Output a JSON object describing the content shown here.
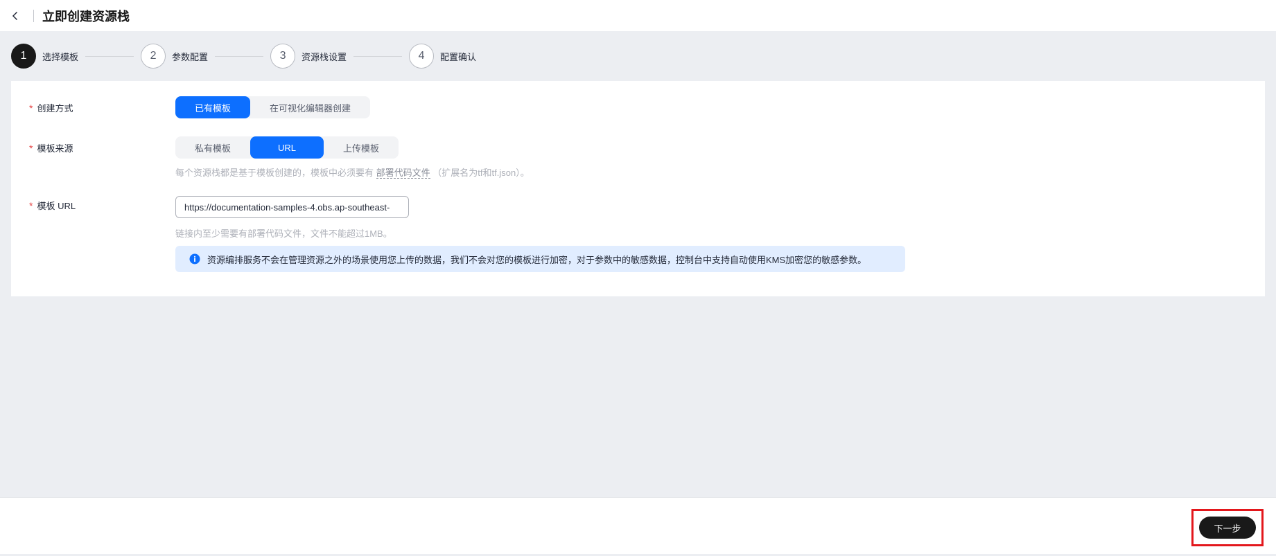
{
  "header": {
    "title": "立即创建资源栈"
  },
  "steps": [
    {
      "number": "1",
      "label": "选择模板"
    },
    {
      "number": "2",
      "label": "参数配置"
    },
    {
      "number": "3",
      "label": "资源栈设置"
    },
    {
      "number": "4",
      "label": "配置确认"
    }
  ],
  "form": {
    "creation_method": {
      "label": "创建方式",
      "options": [
        "已有模板",
        "在可视化编辑器创建"
      ],
      "selected": "已有模板"
    },
    "template_source": {
      "label": "模板来源",
      "options": [
        "私有模板",
        "URL",
        "上传模板"
      ],
      "selected": "URL",
      "hint_prefix": "每个资源栈都是基于模板创建的，模板中必须要有",
      "hint_link": "部署代码文件",
      "hint_suffix": "（扩展名为tf和tf.json）。"
    },
    "template_url": {
      "label": "模板 URL",
      "value": "https://documentation-samples-4.obs.ap-southeast-",
      "hint": "链接内至少需要有部署代码文件，文件不能超过1MB。"
    },
    "info_message": "资源编排服务不会在管理资源之外的场景使用您上传的数据，我们不会对您的模板进行加密，对于参数中的敏感数据，控制台中支持自动使用KMS加密您的敏感参数。"
  },
  "footer": {
    "next_label": "下一步"
  },
  "colors": {
    "primary": "#0d6fff",
    "dark": "#191919",
    "required": "#e54545",
    "highlight": "#e3171c",
    "info_bg": "#e1edff"
  }
}
